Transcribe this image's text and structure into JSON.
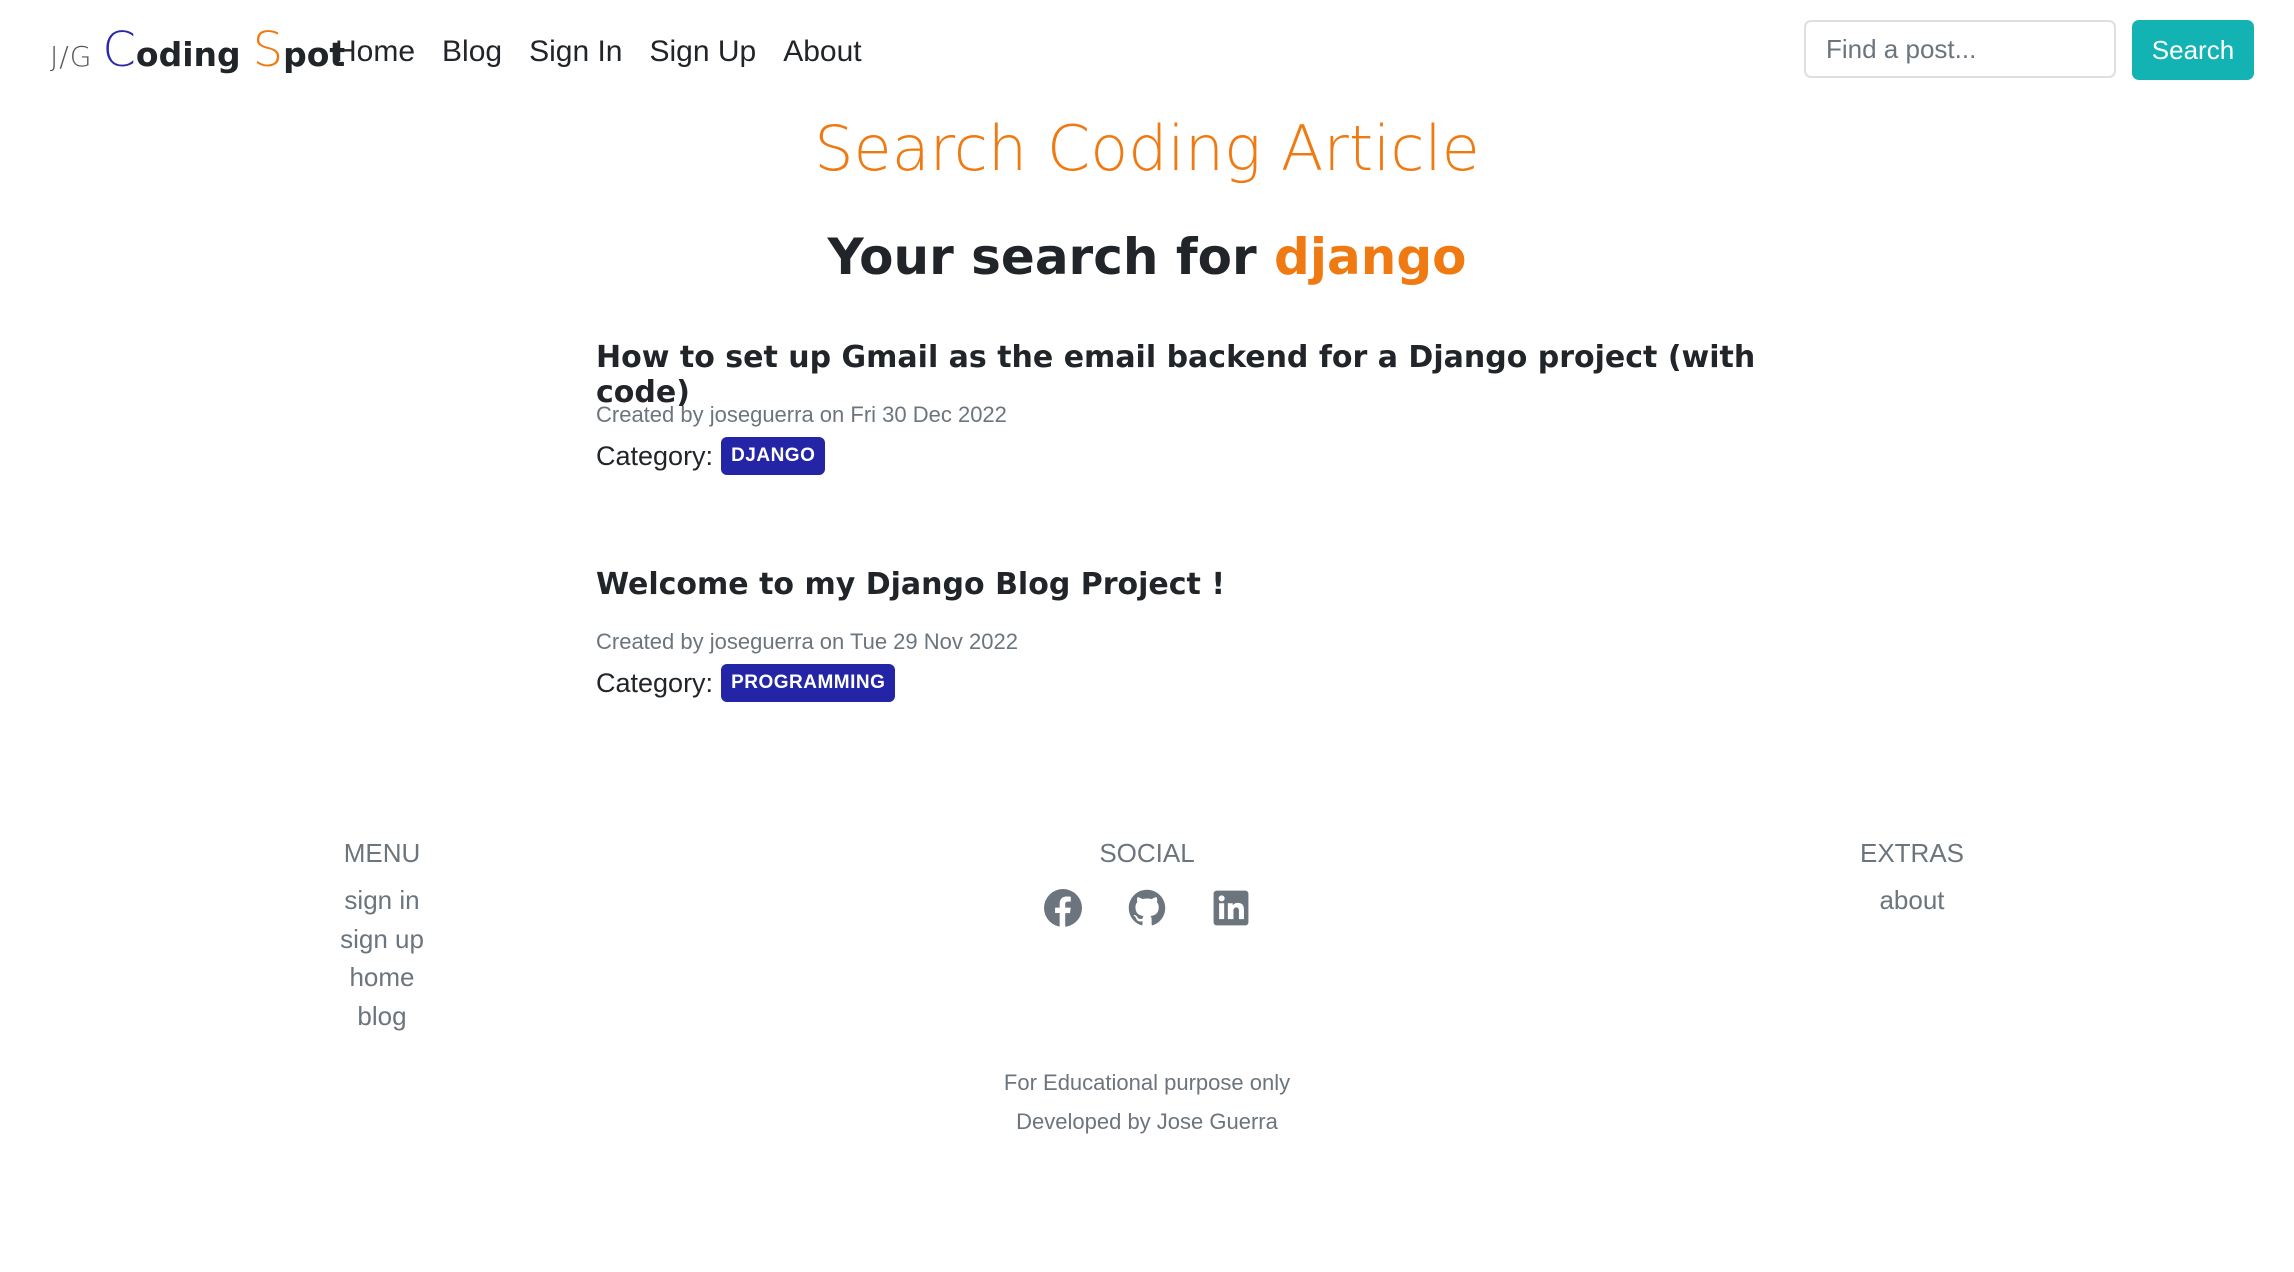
{
  "brand": {
    "prefix": "J/G",
    "c_letter": "C",
    "c_rest": "oding",
    "s_letter": "S",
    "s_rest": "pot"
  },
  "nav": {
    "items": [
      "Home",
      "Blog",
      "Sign In",
      "Sign Up",
      "About"
    ]
  },
  "search": {
    "placeholder": "Find a post...",
    "button_label": "Search"
  },
  "page": {
    "title": "Search Coding Article",
    "heading_prefix": "Your search for",
    "query": "django"
  },
  "results": [
    {
      "title": "How to set up Gmail as the email backend for a Django project (with code)",
      "meta": "Created by joseguerra on Fri 30 Dec 2022",
      "category_label": "Category:",
      "category": "DJANGO"
    },
    {
      "title": "Welcome to my Django Blog Project !",
      "meta": "Created by joseguerra on Tue 29 Nov 2022",
      "category_label": "Category:",
      "category": "PROGRAMMING"
    }
  ],
  "footer": {
    "menu": {
      "heading": "MENU",
      "links": [
        "sign in",
        "sign up",
        "home",
        "blog"
      ]
    },
    "social": {
      "heading": "SOCIAL",
      "icons": [
        "facebook-icon",
        "github-icon",
        "linkedin-icon"
      ]
    },
    "extras": {
      "heading": "EXTRAS",
      "links": [
        "about"
      ]
    },
    "note": "For Educational purpose only",
    "credit": "Developed by Jose Guerra"
  },
  "colors": {
    "accent": "#f07a12",
    "brand_blue": "#2a2aa8",
    "badge": "#2424a6",
    "search_button": "#13b3b3",
    "muted": "#6c757d"
  }
}
